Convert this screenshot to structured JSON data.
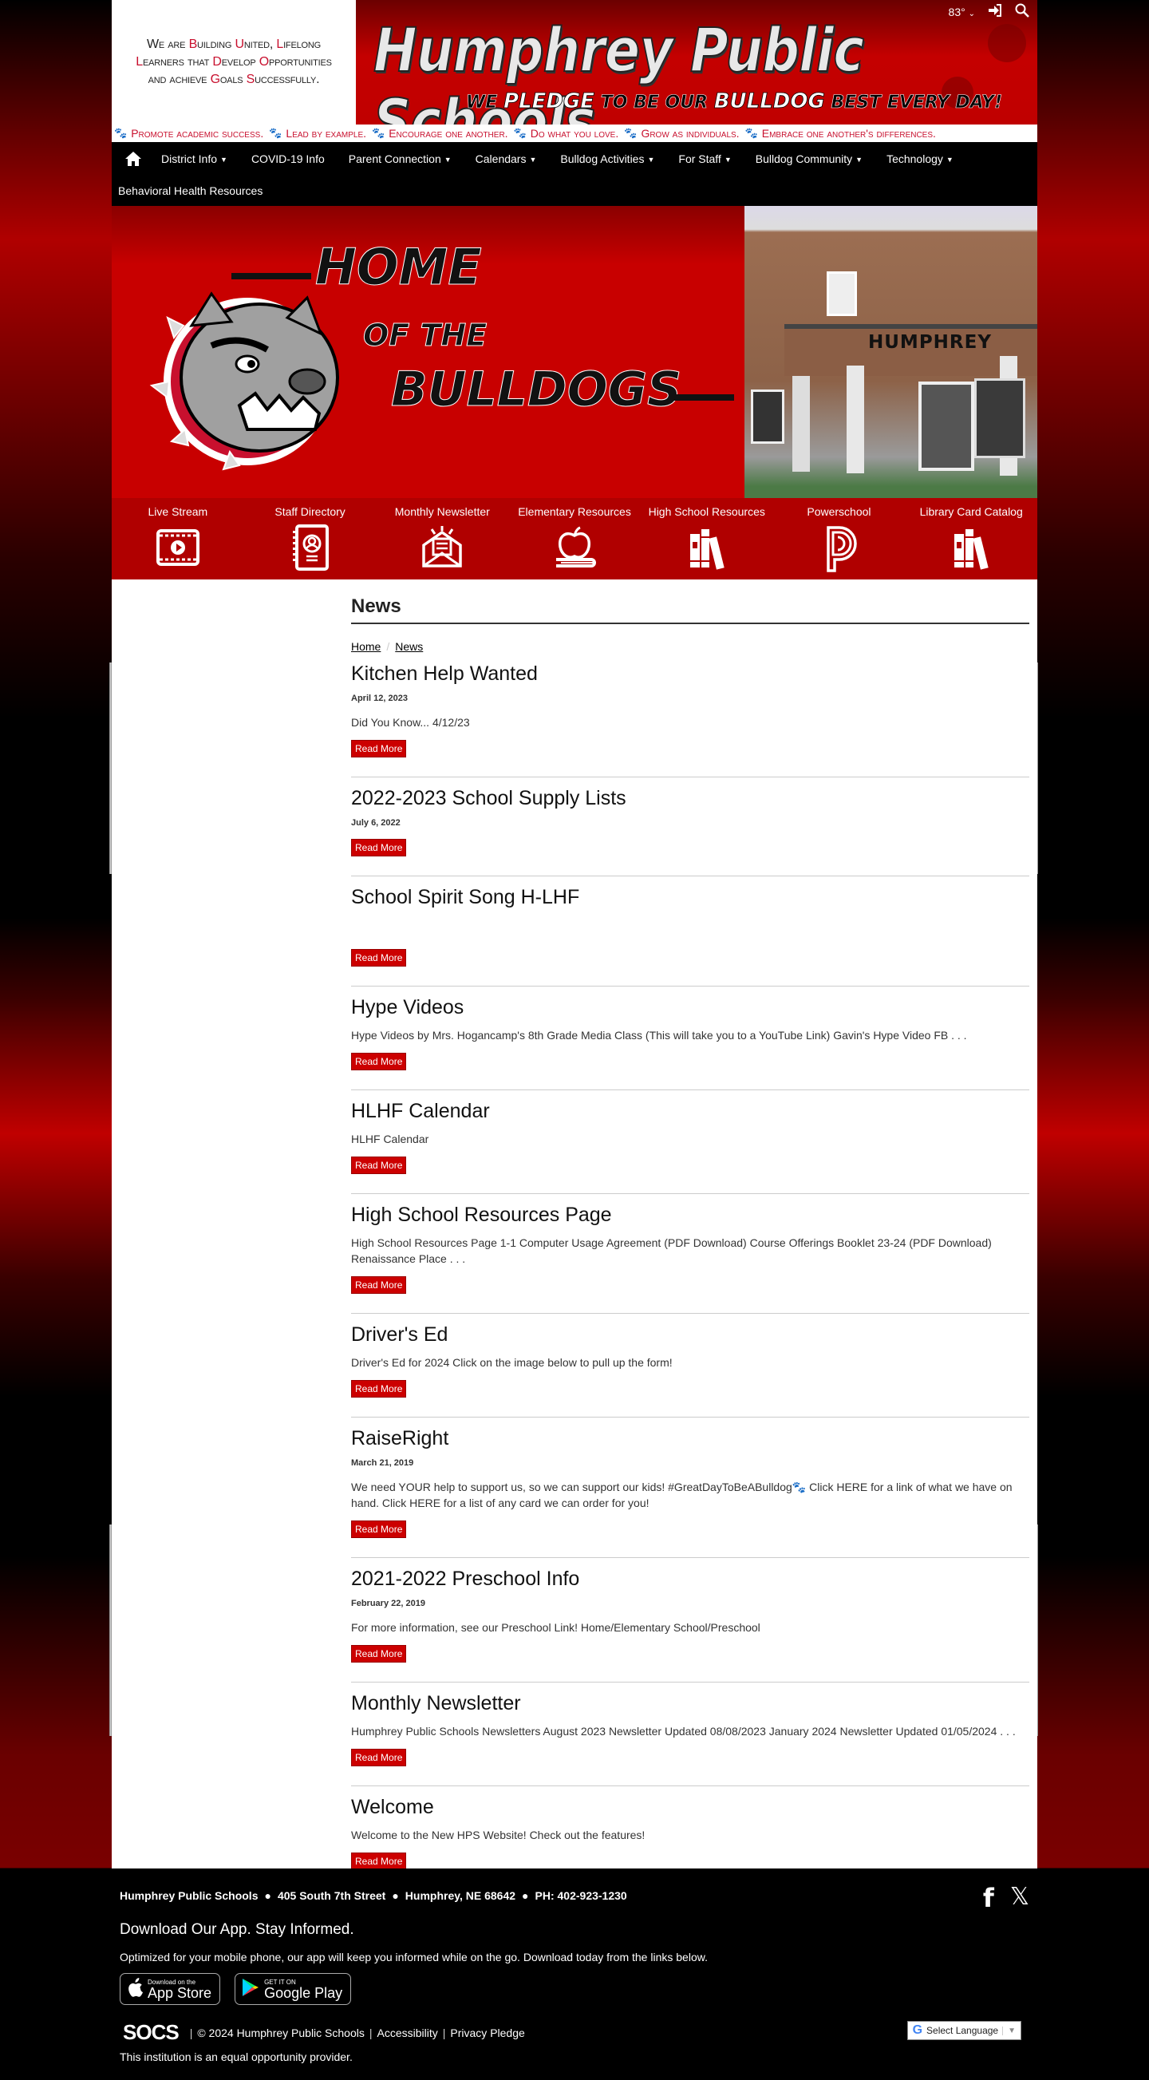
{
  "header": {
    "mission_lines": [
      [
        [
          "We are ",
          false
        ],
        [
          "B",
          true
        ],
        [
          "uilding ",
          false
        ],
        [
          "U",
          true
        ],
        [
          "nited, ",
          false
        ],
        [
          "L",
          true
        ],
        [
          "ifelong",
          false
        ]
      ],
      [
        [
          "L",
          true
        ],
        [
          "earners that ",
          false
        ],
        [
          "D",
          true
        ],
        [
          "evelop ",
          false
        ],
        [
          "O",
          true
        ],
        [
          "pportunities",
          false
        ]
      ],
      [
        [
          "and achieve ",
          false
        ],
        [
          "G",
          true
        ],
        [
          "oals ",
          false
        ],
        [
          "S",
          true
        ],
        [
          "uccessfully.",
          false
        ]
      ]
    ],
    "title": "Humphrey Public Schools",
    "tagline_parts": [
      "WE",
      "PLEDGE",
      "TO BE OUR",
      "BULLDOG",
      "BEST EVERY DAY!"
    ],
    "weather": "83°",
    "weather_icon": "chevron-down-icon",
    "signin_icon": "sign-in-icon",
    "search_icon": "search-icon"
  },
  "values": [
    "Promote academic success.",
    "Lead by example.",
    "Encourage one another.",
    "Do what you love.",
    "Grow as individuals.",
    "Embrace one another's differences."
  ],
  "nav": {
    "home_icon": "home-icon",
    "items": [
      {
        "label": "District Info",
        "dropdown": true
      },
      {
        "label": "COVID-19 Info",
        "dropdown": false
      },
      {
        "label": "Parent Connection",
        "dropdown": true
      },
      {
        "label": "Calendars",
        "dropdown": true
      },
      {
        "label": "Bulldog Activities",
        "dropdown": true
      },
      {
        "label": "For Staff",
        "dropdown": true
      },
      {
        "label": "Bulldog Community",
        "dropdown": true
      },
      {
        "label": "Technology",
        "dropdown": true
      }
    ],
    "row2": "Behavioral Health Resources"
  },
  "hero": {
    "text_lines": [
      "Home",
      "of the",
      "Bulldogs"
    ],
    "building_sign": "HUMPHREY"
  },
  "quick_links": [
    {
      "label": "Live Stream",
      "icon": "video-play-icon"
    },
    {
      "label": "Staff Directory",
      "icon": "contact-book-icon"
    },
    {
      "label": "Monthly Newsletter",
      "icon": "newsletter-envelope-icon"
    },
    {
      "label": "Elementary Resources",
      "icon": "apple-book-icon"
    },
    {
      "label": "High School Resources",
      "icon": "books-icon"
    },
    {
      "label": "Powerschool",
      "icon": "powerschool-p-icon"
    },
    {
      "label": "Library Card Catalog",
      "icon": "books-icon"
    }
  ],
  "page": {
    "title": "News",
    "breadcrumb": [
      "Home",
      "News"
    ],
    "read_more": "Read More",
    "posts": [
      {
        "title": "Kitchen Help Wanted",
        "date": "April 12, 2023",
        "excerpt": "Did You Know... 4/12/23"
      },
      {
        "title": "2022-2023 School Supply Lists",
        "date": "July 6, 2022",
        "excerpt": ""
      },
      {
        "title": "School Spirit Song H-LHF",
        "date": "",
        "excerpt": ""
      },
      {
        "title": "Hype Videos",
        "date": "",
        "excerpt": "Hype Videos by Mrs. Hogancamp's 8th Grade Media Class (This will take you to a YouTube Link) Gavin's Hype Video FB . . ."
      },
      {
        "title": "HLHF Calendar",
        "date": "",
        "excerpt": "HLHF Calendar"
      },
      {
        "title": "High School Resources Page",
        "date": "",
        "excerpt": "High School Resources Page 1-1 Computer Usage Agreement (PDF Download) Course Offerings Booklet 23-24 (PDF Download) Renaissance Place . . ."
      },
      {
        "title": "Driver's Ed",
        "date": "",
        "excerpt": "Driver's Ed for 2024 Click on the image below to pull up the form!"
      },
      {
        "title": "RaiseRight",
        "date": "March 21, 2019",
        "excerpt": "We need YOUR help to support us, so we can support our kids!  #GreatDayToBeABulldog🐾 Click HERE for a link of what we have on hand. Click HERE for a list of any card we can order for you!"
      },
      {
        "title": "2021-2022 Preschool Info",
        "date": "February 22, 2019",
        "excerpt": "For more information, see our Preschool Link! Home/Elementary School/Preschool"
      },
      {
        "title": "Monthly Newsletter",
        "date": "",
        "excerpt": "Humphrey Public Schools Newsletters August 2023 Newsletter Updated 08/08/2023   January 2024 Newsletter Updated  01/05/2024 . . ."
      },
      {
        "title": "Welcome",
        "date": "",
        "excerpt": "Welcome to the New HPS Website! Check out the features!"
      }
    ]
  },
  "footer": {
    "address_parts": [
      "Humphrey Public Schools",
      "405 South 7th Street",
      "Humphrey, NE  68642",
      "PH: 402-923-1230"
    ],
    "app_heading": "Download Our App. Stay Informed.",
    "app_text": "Optimized for your mobile phone, our app will keep you informed while on the go. Download today from the links below.",
    "app_store": {
      "small": "Download on the",
      "big": "App Store"
    },
    "google_play": {
      "small": "GET IT ON",
      "big": "Google Play"
    },
    "social": [
      "facebook-icon",
      "x-twitter-icon"
    ],
    "socs_logo": "SOCS",
    "copyright": "© 2024 Humphrey Public Schools",
    "links": [
      "Accessibility",
      "Privacy Pledge"
    ],
    "eop": "This institution is an equal opportunity provider.",
    "language": "Select Language"
  },
  "colors": {
    "brand_red": "#cc0000",
    "nav_bg": "#000000",
    "quicklinks_bg": "#b00000",
    "values_text": "#c8102e"
  }
}
